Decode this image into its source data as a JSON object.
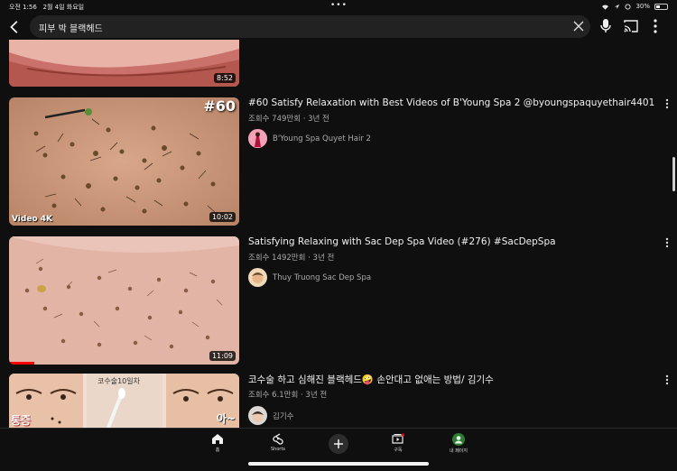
{
  "status_bar": {
    "time": "오전 1:56",
    "date": "2월 4일 화요일",
    "battery": "30%"
  },
  "search": {
    "query": "피부 박 블랙헤드"
  },
  "videos": [
    {
      "duration": "8:52"
    },
    {
      "thumb_badge": "#60",
      "thumb_caption": "Video 4K",
      "duration": "10:02",
      "title": "#60 Satisfy Relaxation with Best Videos of B'Young Spa 2 @byoungspaquyethair4401",
      "meta": "조회수 749만회 · 3년 전",
      "channel": "B'Young Spa Quyet Hair 2"
    },
    {
      "duration": "11:09",
      "title": "Satisfying Relaxing with Sac Dep Spa Video (#276) #SacDepSpa",
      "meta": "조회수 1492만회 · 3년 전",
      "channel": "Thuy Truong Sac Dep Spa"
    },
    {
      "thumb_caption_mid": "코수술10일차",
      "thumb_caption_left": "통증",
      "thumb_caption_right": "아~",
      "title": "코수술 하고 심해진 블랙헤드🤪 손안대고 없애는 방법/ 김기수",
      "meta": "조회수 6.1만회 · 3년 전",
      "channel": "김기수"
    }
  ],
  "nav": {
    "home": "홈",
    "shorts": "Shorts",
    "subscriptions": "구독",
    "profile": "내 페이지"
  },
  "colors": {
    "background": "#0f0f0f",
    "search_bg": "#222222",
    "subscription_dot": "#ff0000",
    "profile_avatar": "#2e7d32"
  }
}
